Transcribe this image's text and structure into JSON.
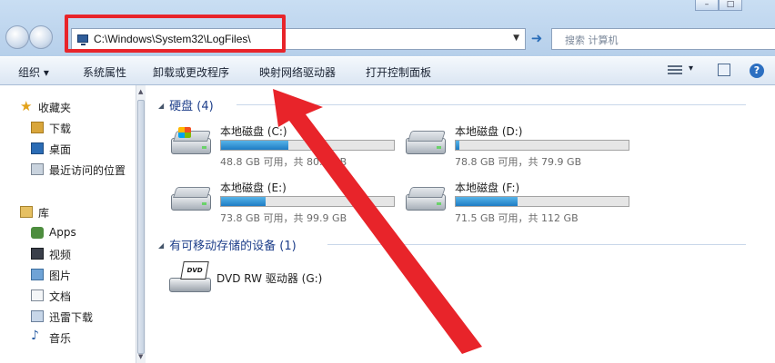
{
  "window": {
    "controls": [
      "–",
      "□",
      "✕"
    ]
  },
  "address": {
    "path": "C:\\Windows\\System32\\LogFiles\\",
    "drop": "▼",
    "go": "➜"
  },
  "search": {
    "placeholder": "搜索 计算机"
  },
  "toolbar": {
    "items": [
      "组织 ▾",
      "系统属性",
      "卸载或更改程序",
      "映射网络驱动器",
      "打开控制面板"
    ],
    "view_drop": "▾",
    "help": "?"
  },
  "nav": {
    "favorites": "收藏夹",
    "downloads": "下载",
    "desktop": "桌面",
    "recent": "最近访问的位置",
    "libraries": "库",
    "apps": "Apps",
    "videos": "视频",
    "pictures": "图片",
    "documents": "文档",
    "thunder": "迅雷下载",
    "music": "音乐"
  },
  "content": {
    "hdd_group": "硬盘 (4)",
    "removable_group": "有可移动存储的设备 (1)",
    "drives": [
      {
        "name": "本地磁盘 (C:)",
        "free": "48.8 GB 可用，共 80.0 GB",
        "used_fraction": 0.39
      },
      {
        "name": "本地磁盘 (D:)",
        "free": "78.8 GB 可用，共 79.9 GB",
        "used_fraction": 0.02
      },
      {
        "name": "本地磁盘 (E:)",
        "free": "73.8 GB 可用，共 99.9 GB",
        "used_fraction": 0.26
      },
      {
        "name": "本地磁盘 (F:)",
        "free": "71.5 GB 可用，共 112 GB",
        "used_fraction": 0.36
      }
    ],
    "dvd": {
      "name": "DVD RW 驱动器 (G:)",
      "label": "DVD"
    }
  },
  "colors": {
    "highlight": "#e8242a",
    "bar_fill": "#1e7cc4",
    "group_header": "#1e3f8a"
  }
}
